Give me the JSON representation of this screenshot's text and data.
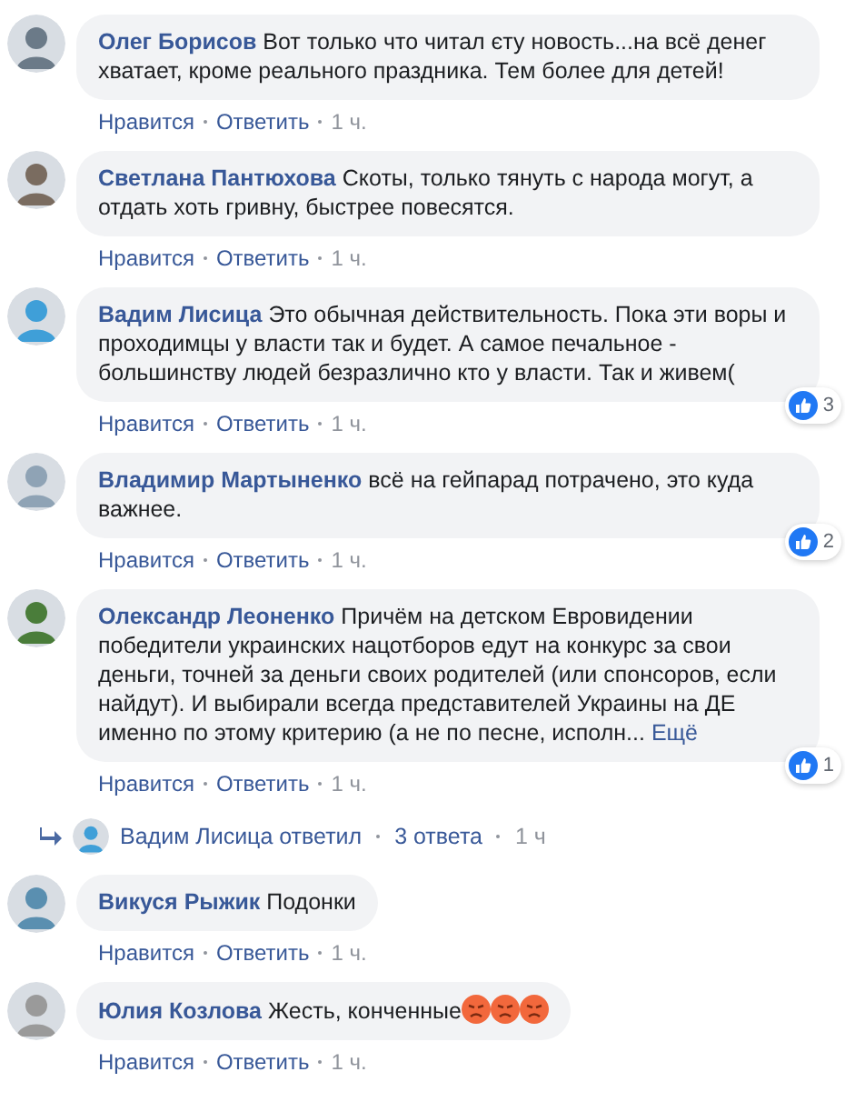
{
  "comments": [
    {
      "author": "Олег Борисов",
      "text": "Вот только что читал єту новость...на всё денег хватает, кроме реального праздника. Тем более для детей!",
      "actions": [
        "Нравится",
        "Ответить"
      ],
      "time": "1 ч."
    },
    {
      "author": "Светлана Пантюхова",
      "text": "Скоты, только тянуть с народа могут, а отдать хоть гривну, быстрее повесятся.",
      "actions": [
        "Нравится",
        "Ответить"
      ],
      "time": "1 ч."
    },
    {
      "author": "Вадим Лисица",
      "text": "Это обычная действительность. Пока эти воры и проходимцы у власти так и будет. А самое печальное - большинству людей безразлично кто у власти. Так и живем(",
      "likes": "3",
      "actions": [
        "Нравится",
        "Ответить"
      ],
      "time": "1 ч."
    },
    {
      "author": "Владимир Мартыненко",
      "text": "всё на гейпарад потрачено, это куда важнее.",
      "likes": "2",
      "actions": [
        "Нравится",
        "Ответить"
      ],
      "time": "1 ч."
    },
    {
      "author": "Олександр Леоненко",
      "text": "Причём на детском Евровидении победители украинских нацотборов едут на конкурс за свои деньги, точней за деньги своих родителей (или спонсоров, если найдут). И выбирали всегда представителей Украины на ДЕ именно по этому критерию (а не по песне, исполн...",
      "more": "Ещё",
      "likes": "1",
      "actions": [
        "Нравится",
        "Ответить"
      ],
      "time": "1 ч.",
      "reply": {
        "text": "Вадим Лисица ответил",
        "count": "3 ответа",
        "time": "1 ч"
      }
    },
    {
      "author": "Викуся Рыжик",
      "text": "Подонки",
      "actions": [
        "Нравится",
        "Ответить"
      ],
      "time": "1 ч."
    },
    {
      "author": "Юлия Козлова",
      "text": "Жесть, конченные",
      "emoji": [
        {
          "kind": "angry"
        },
        {
          "kind": "angry"
        },
        {
          "kind": "angry"
        }
      ],
      "actions": [
        "Нравится",
        "Ответить"
      ],
      "time": "1 ч."
    }
  ]
}
